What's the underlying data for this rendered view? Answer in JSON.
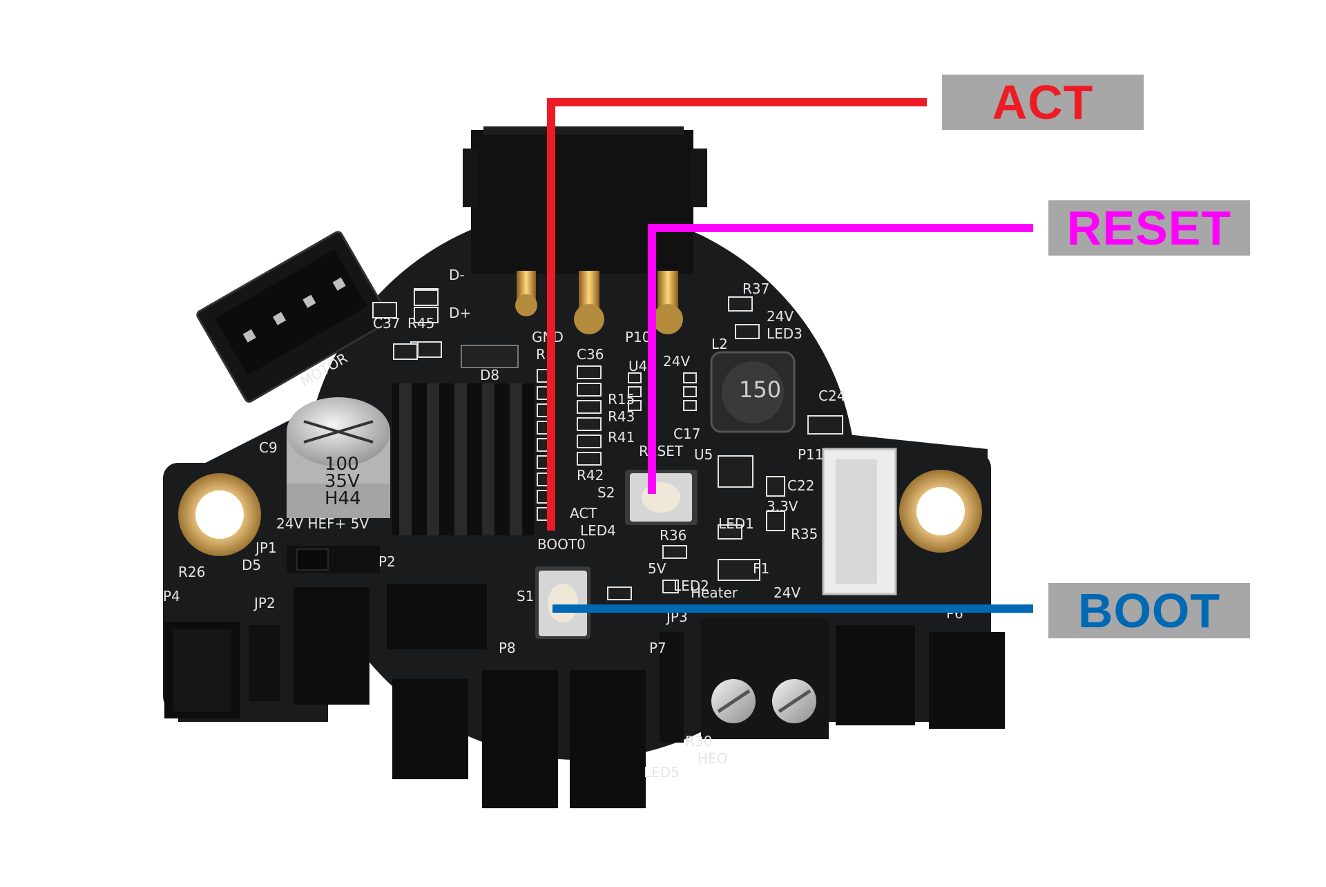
{
  "callouts": {
    "act": {
      "label": "ACT",
      "color": "#ed1c24"
    },
    "reset": {
      "label": "RESET",
      "color": "#ff00ff"
    },
    "boot": {
      "label": "BOOT",
      "color": "#0069b4"
    }
  },
  "board": {
    "pcb_color": "#1a1b1d",
    "silkscreen": {
      "d_minus": "D-",
      "d_plus": "D+",
      "gnd": "GND",
      "p10": "P10",
      "v24": "24V",
      "r37": "R37",
      "led3_v": "24V",
      "led3": "LED3",
      "l2": "L2",
      "inductor": "150",
      "c24": "C24",
      "u4": "U4",
      "c36": "C36",
      "r15": "R15",
      "r43": "R43",
      "r41": "R41",
      "r42": "R42",
      "r1": "R1",
      "d8": "D8",
      "reset": "RESET",
      "c17": "C17",
      "u5": "U5",
      "s2": "S2",
      "p11": "P11",
      "c22": "C22",
      "v33": "3.3V",
      "r35": "R35",
      "act": "ACT",
      "led4": "LED4",
      "boot0": "BOOT0",
      "r36": "R36",
      "led1": "LED1",
      "s1": "S1",
      "v5": "5V",
      "led2": "LED2",
      "f1": "F1",
      "v24b": "24V",
      "heater": "Heater",
      "jp3": "JP3",
      "p7": "P7",
      "p8": "P8",
      "r30": "R30",
      "heo": "HEO",
      "led5": "LED5",
      "c9": "C9",
      "cap_value": "100",
      "cap_voltage": "35V",
      "cap_code": "H44",
      "jp1": "JP1",
      "jumper_opts": "24V  HEF+ 5V",
      "d5": "D5",
      "r26": "R26",
      "jp2": "JP2",
      "p4": "P4",
      "p2": "P2",
      "p6": "P6",
      "motor": "MOTOR",
      "c37": "C37",
      "r45": "R45"
    }
  }
}
